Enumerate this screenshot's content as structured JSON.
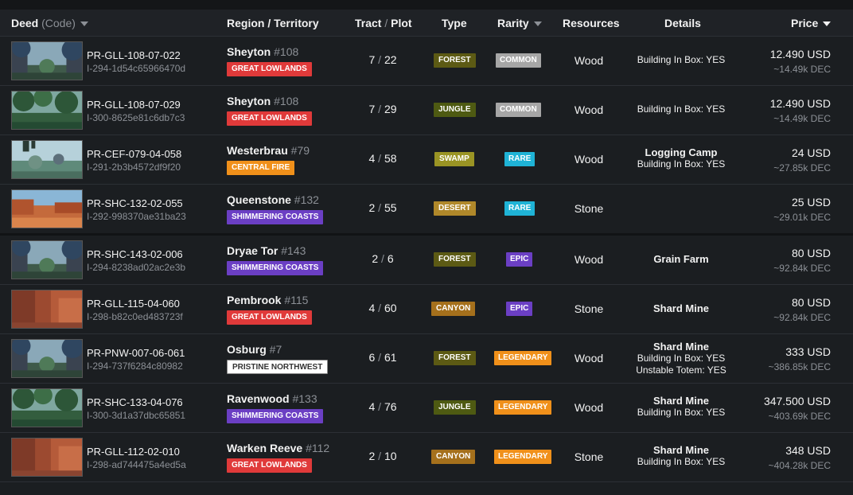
{
  "header": {
    "deed": "Deed",
    "deed_code": "(Code)",
    "region": "Region / Territory",
    "tract": "Tract",
    "tract_sep": "/",
    "plot": "Plot",
    "type": "Type",
    "rarity": "Rarity",
    "resources": "Resources",
    "details": "Details",
    "price": "Price"
  },
  "rows": [
    {
      "code": "PR-GLL-108-07-022",
      "hash": "I-294-1d54c65966470d",
      "region": "Sheyton",
      "region_num": "#108",
      "territory": "GREAT LOWLANDS",
      "tract": "7",
      "plot": "22",
      "type": "FOREST",
      "rarity": "COMMON",
      "resource": "Wood",
      "detail_main": "",
      "detail_lines": [
        "Building In Box: YES"
      ],
      "price": "12.490 USD",
      "dec": "~14.49k DEC",
      "thumb": "forest"
    },
    {
      "code": "PR-GLL-108-07-029",
      "hash": "I-300-8625e81c6db7c3",
      "region": "Sheyton",
      "region_num": "#108",
      "territory": "GREAT LOWLANDS",
      "tract": "7",
      "plot": "29",
      "type": "JUNGLE",
      "rarity": "COMMON",
      "resource": "Wood",
      "detail_main": "",
      "detail_lines": [
        "Building In Box: YES"
      ],
      "price": "12.490 USD",
      "dec": "~14.49k DEC",
      "thumb": "jungle"
    },
    {
      "code": "PR-CEF-079-04-058",
      "hash": "I-291-2b3b4572df9f20",
      "region": "Westerbrau",
      "region_num": "#79",
      "territory": "CENTRAL FIRE",
      "tract": "4",
      "plot": "58",
      "type": "SWAMP",
      "rarity": "RARE",
      "resource": "Wood",
      "detail_main": "Logging Camp",
      "detail_lines": [
        "Building In Box: YES"
      ],
      "price": "24 USD",
      "dec": "~27.85k DEC",
      "thumb": "swamp"
    },
    {
      "code": "PR-SHC-132-02-055",
      "hash": "I-292-998370ae31ba23",
      "region": "Queenstone",
      "region_num": "#132",
      "territory": "SHIMMERING COASTS",
      "tract": "2",
      "plot": "55",
      "type": "DESERT",
      "rarity": "RARE",
      "resource": "Stone",
      "detail_main": "",
      "detail_lines": [],
      "price": "25 USD",
      "dec": "~29.01k DEC",
      "thumb": "desert"
    },
    {
      "code": "PR-SHC-143-02-006",
      "hash": "I-294-8238ad02ac2e3b",
      "region": "Dryae Tor",
      "region_num": "#143",
      "territory": "SHIMMERING COASTS",
      "tract": "2",
      "plot": "6",
      "type": "FOREST",
      "rarity": "EPIC",
      "resource": "Wood",
      "detail_main": "Grain Farm",
      "detail_lines": [],
      "price": "80 USD",
      "dec": "~92.84k DEC",
      "thumb": "forest"
    },
    {
      "code": "PR-GLL-115-04-060",
      "hash": "I-298-b82c0ed483723f",
      "region": "Pembrook",
      "region_num": "#115",
      "territory": "GREAT LOWLANDS",
      "tract": "4",
      "plot": "60",
      "type": "CANYON",
      "rarity": "EPIC",
      "resource": "Stone",
      "detail_main": "Shard Mine",
      "detail_lines": [],
      "price": "80 USD",
      "dec": "~92.84k DEC",
      "thumb": "canyon"
    },
    {
      "code": "PR-PNW-007-06-061",
      "hash": "I-294-737f6284c80982",
      "region": "Osburg",
      "region_num": "#7",
      "territory": "PRISTINE NORTHWEST",
      "tract": "6",
      "plot": "61",
      "type": "FOREST",
      "rarity": "LEGENDARY",
      "resource": "Wood",
      "detail_main": "Shard Mine",
      "detail_lines": [
        "Building In Box: YES",
        "Unstable Totem: YES"
      ],
      "price": "333 USD",
      "dec": "~386.85k DEC",
      "thumb": "forest"
    },
    {
      "code": "PR-SHC-133-04-076",
      "hash": "I-300-3d1a37dbc65851",
      "region": "Ravenwood",
      "region_num": "#133",
      "territory": "SHIMMERING COASTS",
      "tract": "4",
      "plot": "76",
      "type": "JUNGLE",
      "rarity": "LEGENDARY",
      "resource": "Wood",
      "detail_main": "Shard Mine",
      "detail_lines": [
        "Building In Box: YES"
      ],
      "price": "347.500 USD",
      "dec": "~403.69k DEC",
      "thumb": "jungle"
    },
    {
      "code": "PR-GLL-112-02-010",
      "hash": "I-298-ad744475a4ed5a",
      "region": "Warken Reeve",
      "region_num": "#112",
      "territory": "GREAT LOWLANDS",
      "tract": "2",
      "plot": "10",
      "type": "CANYON",
      "rarity": "LEGENDARY",
      "resource": "Stone",
      "detail_main": "Shard Mine",
      "detail_lines": [
        "Building In Box: YES"
      ],
      "price": "348 USD",
      "dec": "~404.28k DEC",
      "thumb": "canyon"
    }
  ],
  "colors": {
    "territory": {
      "GREAT LOWLANDS": "#e03a3a",
      "CENTRAL FIRE": "#f0901a",
      "SHIMMERING COASTS": "#6b3fc4",
      "PRISTINE NORTHWEST": "#ffffff"
    },
    "type": {
      "FOREST": "#5c5a14",
      "JUNGLE": "#4e5a12",
      "SWAMP": "#9a9424",
      "DESERT": "#b0882a",
      "CANYON": "#a5701c"
    },
    "rarity": {
      "COMMON": "#a6a6a6",
      "RARE": "#1fb3d6",
      "EPIC": "#6b3fc4",
      "LEGENDARY": "#f0901a"
    }
  }
}
